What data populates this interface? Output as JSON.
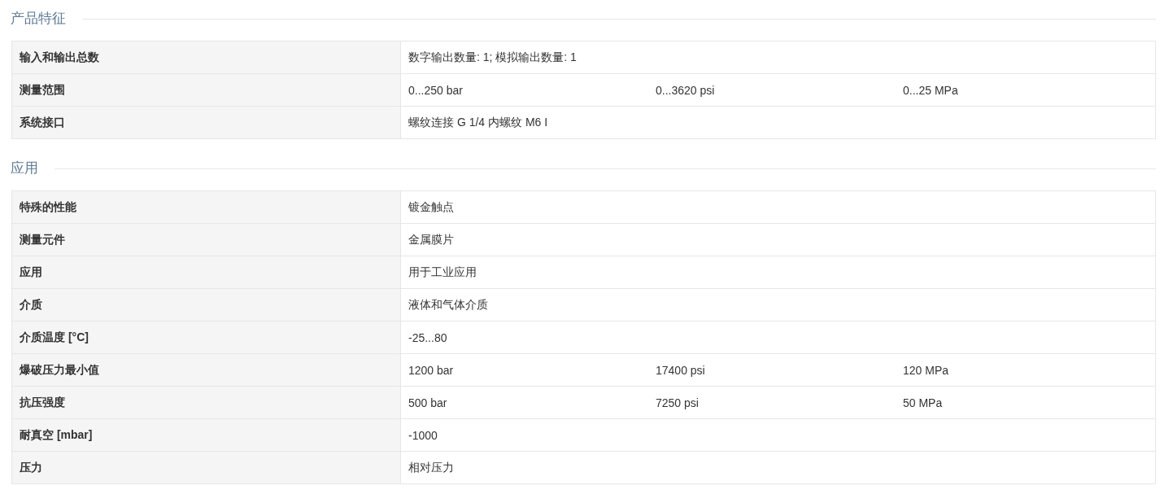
{
  "sections": [
    {
      "title": "产品特征",
      "rows": [
        {
          "label": "输入和输出总数",
          "values": [
            "数字输出数量: 1; 模拟输出数量: 1"
          ]
        },
        {
          "label": "测量范围",
          "values": [
            "0...250 bar",
            "0...3620 psi",
            "0...25 MPa"
          ]
        },
        {
          "label": "系统接口",
          "values": [
            "螺纹连接 G 1/4 内螺纹 M6 I"
          ]
        }
      ]
    },
    {
      "title": "应用",
      "rows": [
        {
          "label": "特殊的性能",
          "values": [
            "镀金触点"
          ]
        },
        {
          "label": "测量元件",
          "values": [
            "金属膜片"
          ]
        },
        {
          "label": "应用",
          "values": [
            "用于工业应用"
          ]
        },
        {
          "label": "介质",
          "values": [
            "液体和气体介质"
          ]
        },
        {
          "label": "介质温度 [°C]",
          "values": [
            "-25...80"
          ]
        },
        {
          "label": "爆破压力最小值",
          "values": [
            "1200 bar",
            "17400 psi",
            "120 MPa"
          ]
        },
        {
          "label": "抗压强度",
          "values": [
            "500 bar",
            "7250 psi",
            "50 MPa"
          ]
        },
        {
          "label": "耐真空 [mbar]",
          "values": [
            "-1000"
          ]
        },
        {
          "label": "压力",
          "values": [
            "相对压力"
          ]
        }
      ]
    }
  ]
}
